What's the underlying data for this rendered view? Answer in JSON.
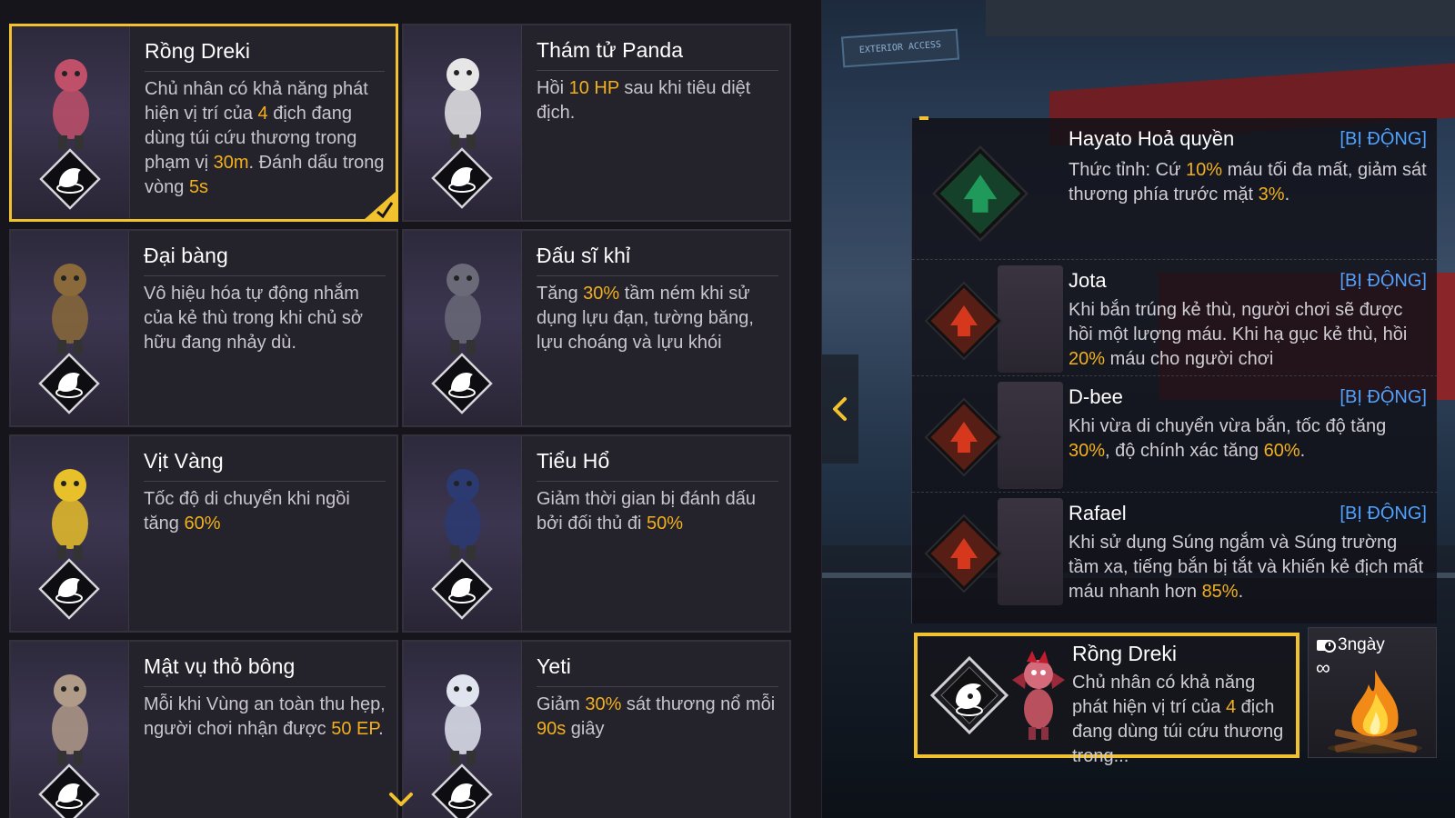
{
  "pets": [
    {
      "name": "Rồng Dreki",
      "desc": [
        "Chủ nhân có khả năng phát hiện vị trí của ",
        {
          "h": "4"
        },
        " địch đang dùng túi cứu thương trong phạm vị ",
        {
          "h": "30m"
        },
        ". Đánh dấu trong vòng ",
        {
          "h": "5s"
        }
      ],
      "selected": true,
      "badge": "dragon-eye-icon",
      "figColor": "#c0506a"
    },
    {
      "name": "Thám tử Panda",
      "desc": [
        "Hồi ",
        {
          "h": "10 HP"
        },
        " sau khi  tiêu diệt địch."
      ],
      "selected": false,
      "badge": "hp-heal-icon",
      "figColor": "#e6e6e6"
    },
    {
      "name": "Đại bàng",
      "desc": [
        "Vô hiệu hóa tự động nhắm của kẻ thù trong khi chủ sở hữu đang nhảy dù."
      ],
      "selected": false,
      "badge": "eagle-icon",
      "figColor": "#8a6a3a"
    },
    {
      "name": "Đấu sĩ khỉ",
      "desc": [
        "Tăng ",
        {
          "h": "30%"
        },
        " tầm ném khi sử dụng lựu đạn, tường băng, lựu choáng và lựu khói"
      ],
      "selected": false,
      "badge": "monkey-throw-icon",
      "figColor": "#6a6a78"
    },
    {
      "name": "Vịt Vàng",
      "desc": [
        "Tốc độ di chuyển khi ngồi tăng ",
        {
          "h": "60%"
        }
      ],
      "selected": false,
      "badge": "duck-speed-icon",
      "figColor": "#e8c02a"
    },
    {
      "name": "Tiểu Hổ",
      "desc": [
        "Giảm thời gian bị đánh dấu bởi đối thủ đi ",
        {
          "h": "50%"
        }
      ],
      "selected": false,
      "badge": "tiger-icon",
      "figColor": "#2c3a72"
    },
    {
      "name": "Mật vụ thỏ bông",
      "desc": [
        "Mỗi khi Vùng an toàn thu hẹp, người chơi nhận được ",
        {
          "h": "50 EP"
        },
        "."
      ],
      "selected": false,
      "badge": "rabbit-icon",
      "figColor": "#b09a88"
    },
    {
      "name": "Yeti",
      "desc": [
        "Giảm ",
        {
          "h": "30%"
        },
        " sát thương nổ mỗi ",
        {
          "h": "90s"
        },
        " giây"
      ],
      "selected": false,
      "badge": "yeti-icon",
      "figColor": "#e0e4ee"
    }
  ],
  "scene": {
    "sign_text": "EXTERIOR ACCESS"
  },
  "skills": [
    {
      "name": "Hayato Hoả quyền",
      "tag": "[BỊ ĐỘNG]",
      "desc": [
        "Thức tỉnh: Cứ ",
        {
          "h": "10%"
        },
        " máu tối đa mất, giảm sát thương phía trước mặt ",
        {
          "h": "3%"
        },
        "."
      ],
      "color": "#1f9a5a",
      "icon": "armor-up-icon"
    },
    {
      "name": "Jota",
      "tag": "[BỊ ĐỘNG]",
      "desc": [
        "Khi bắn trúng kẻ thù, người chơi sẽ được hồi một lượng máu. Khi hạ gục kẻ thù, hồi ",
        {
          "h": "20%"
        },
        " máu cho người chơi"
      ],
      "color": "#d6381e",
      "icon": "gun-heal-icon"
    },
    {
      "name": "D-bee",
      "tag": "[BỊ ĐỘNG]",
      "desc": [
        "Khi vừa di chuyển vừa bắn, tốc độ tăng ",
        {
          "h": "30%"
        },
        ", độ chính xác tăng ",
        {
          "h": "60%"
        },
        "."
      ],
      "color": "#d6381e",
      "icon": "run-aim-icon"
    },
    {
      "name": "Rafael",
      "tag": "[BỊ ĐỘNG]",
      "desc": [
        "Khi sử dụng Súng ngắm và Súng trường tầm xa, tiếng bắn bị tắt và khiến kẻ địch mất máu nhanh hơn ",
        {
          "h": "85%"
        },
        "."
      ],
      "color": "#d6381e",
      "icon": "silent-sniper-icon"
    }
  ],
  "selected_pet": {
    "name": "Rồng Dreki",
    "desc": [
      "Chủ nhân có khả năng phát hiện vị trí của ",
      {
        "h": "4"
      },
      " địch đang dùng túi cứu thương trong..."
    ]
  },
  "item": {
    "duration": "3ngày",
    "infinity": "∞"
  }
}
